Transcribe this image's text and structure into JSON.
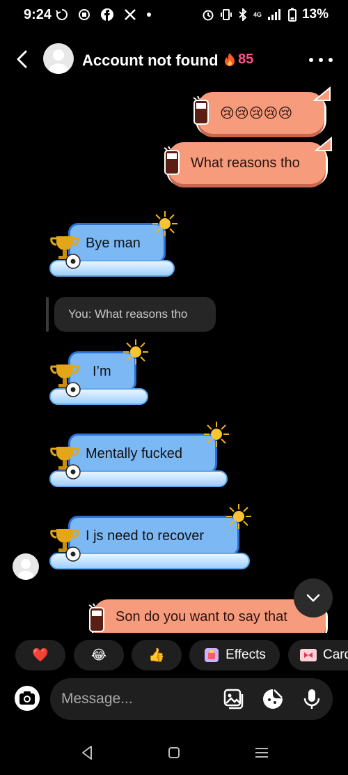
{
  "status_bar": {
    "time": "9:24",
    "battery": "13%",
    "network": "4G"
  },
  "header": {
    "title": "Account not found",
    "streak_count": "85"
  },
  "messages": [
    {
      "direction": "outgoing",
      "text": "😢😢😢😢😢"
    },
    {
      "direction": "outgoing",
      "text": "What reasons tho"
    },
    {
      "direction": "incoming",
      "text": "Bye man"
    },
    {
      "direction": "reply_preview",
      "text": "You: What reasons tho"
    },
    {
      "direction": "incoming",
      "text": "I’m"
    },
    {
      "direction": "incoming",
      "text": "Mentally fucked"
    },
    {
      "direction": "incoming",
      "text": "I js need to recover"
    },
    {
      "direction": "outgoing",
      "text": "Son do you want to say that"
    }
  ],
  "quick_reactions": [
    {
      "icon": "heart-icon",
      "label": "❤️"
    },
    {
      "icon": "laughing-emoji-icon",
      "label": "😂"
    },
    {
      "icon": "thumbs-up-icon",
      "label": "👍"
    },
    {
      "icon": "effects-icon",
      "label": "Effects"
    },
    {
      "icon": "card-icon",
      "label": "Card"
    }
  ],
  "composer": {
    "placeholder": "Message..."
  },
  "colors": {
    "outgoing_bubble": "#f79b7d",
    "incoming_bubble": "#7cb8f4",
    "incoming_border": "#2a72d6",
    "streak": "#ff4f8b"
  }
}
